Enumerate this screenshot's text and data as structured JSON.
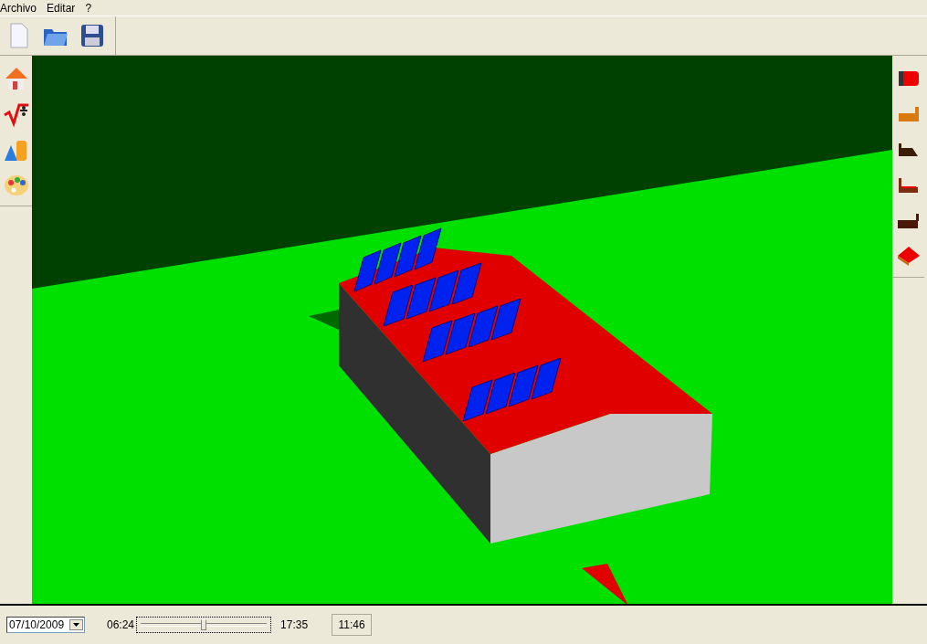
{
  "menu": [
    "Archivo",
    "Editar",
    "?"
  ],
  "date_field": {
    "value": "07/10/2009"
  },
  "time_slider": {
    "start": "06:24",
    "end": "17:35",
    "level": 0.5
  },
  "current_time": "11:46"
}
